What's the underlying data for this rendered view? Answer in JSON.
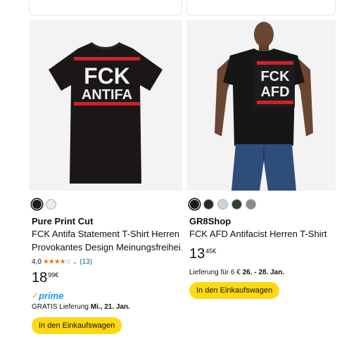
{
  "products": [
    {
      "brand": "Pure Print Cut",
      "title_line1": "FCK Antifa Statement T-Shirt Herren",
      "title_line2": "Provokantes Design Meinungsfreihei…",
      "print_text_1": "FCK",
      "print_text_2": "ANTIFA",
      "swatches": [
        "#1c1c1c",
        "#ececec"
      ],
      "rating_value": "4,0",
      "rating_stars": 4,
      "rating_count": "(13)",
      "price_whole": "18",
      "price_fraction": "99",
      "price_currency": "€",
      "prime_label": "prime",
      "delivery_prefix": "GRATIS Lieferung ",
      "delivery_date": "Mi., 21. Jan.",
      "cart_button": "In den Einkaufswagen"
    },
    {
      "brand": "GR8Shop",
      "title_line1": "FCK AFD Antifacist Herren T-Shirt",
      "print_text_1": "FCK",
      "print_text_2": "AFD",
      "swatches": [
        "#1c1c1c",
        "#2a2a2a",
        "#cfd3da",
        "#2f3e2f",
        "#8a8a8a"
      ],
      "price_whole": "13",
      "price_fraction": "45",
      "price_currency": "€",
      "delivery_prefix": "Lieferung für 6 € ",
      "delivery_date": "26. - 28. Jan.",
      "cart_button": "In den Einkaufswagen"
    }
  ],
  "colors": {
    "accent_button": "#ffd814",
    "link": "#007185",
    "star": "#de7921",
    "prime_blue": "#1a98ff",
    "print_red": "#d2202a"
  }
}
